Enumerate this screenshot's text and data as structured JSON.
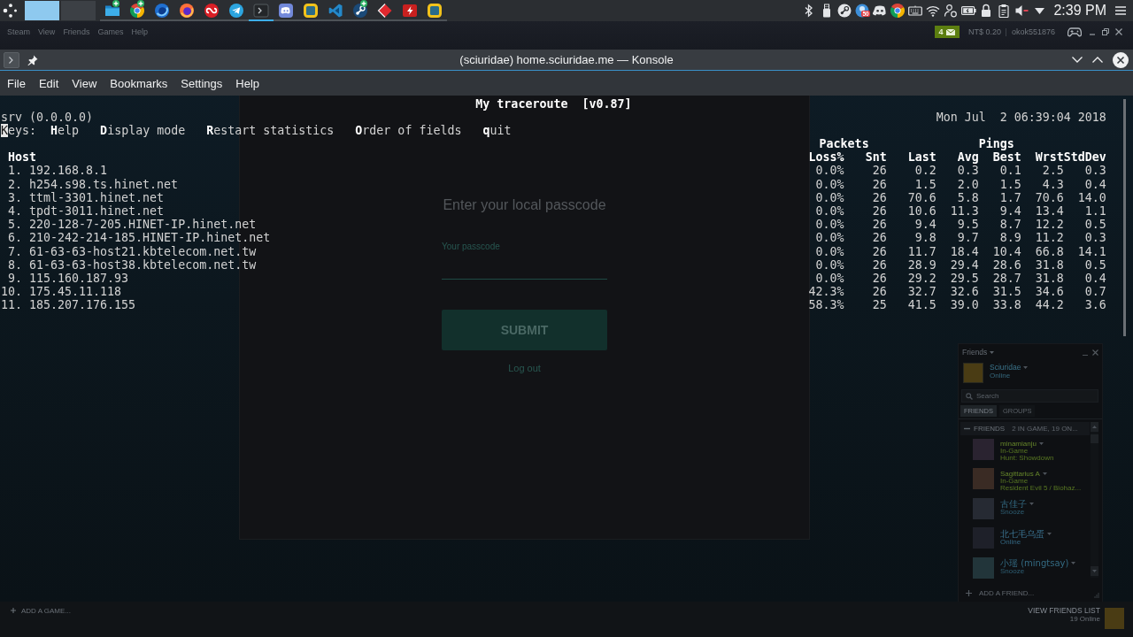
{
  "taskbar": {
    "desktops": [
      {
        "selected": true
      },
      {
        "selected": false
      }
    ],
    "apps": [
      {
        "kind": "folder",
        "badge": true,
        "running": true,
        "selected": false
      },
      {
        "kind": "chrome",
        "badge": true,
        "running": true,
        "selected": false
      },
      {
        "kind": "devfox",
        "badge": false,
        "running": true,
        "selected": false
      },
      {
        "kind": "firefox",
        "badge": false,
        "running": true,
        "selected": false
      },
      {
        "kind": "cloud",
        "badge": false,
        "running": true,
        "selected": false
      },
      {
        "kind": "telegram",
        "badge": false,
        "running": true,
        "selected": false
      },
      {
        "kind": "terminal",
        "badge": false,
        "running": true,
        "selected": true
      },
      {
        "kind": "discord",
        "badge": false,
        "running": true,
        "selected": false
      },
      {
        "kind": "frame",
        "badge": false,
        "running": true,
        "selected": false
      },
      {
        "kind": "code",
        "badge": false,
        "running": true,
        "selected": false
      },
      {
        "kind": "steam",
        "badge": true,
        "running": true,
        "selected": false
      },
      {
        "kind": "diamond",
        "badge": false,
        "running": true,
        "selected": false
      },
      {
        "kind": "bolt",
        "badge": false,
        "running": true,
        "selected": false
      },
      {
        "kind": "frame",
        "badge": false,
        "running": true,
        "selected": false
      }
    ],
    "tray": [
      {
        "kind": "bluetooth"
      },
      {
        "kind": "usb"
      },
      {
        "kind": "steam"
      },
      {
        "kind": "badged",
        "badge": "50"
      },
      {
        "kind": "discord"
      },
      {
        "kind": "chrome"
      },
      {
        "kind": "keyboard"
      },
      {
        "kind": "wifi"
      },
      {
        "kind": "user"
      },
      {
        "kind": "battery"
      },
      {
        "kind": "lock"
      },
      {
        "kind": "clipboard"
      },
      {
        "kind": "muted"
      },
      {
        "kind": "expand"
      }
    ],
    "clock": "2:39 PM"
  },
  "steam": {
    "menu": [
      "Steam",
      "View",
      "Friends",
      "Games",
      "Help"
    ],
    "notifications": "4",
    "wallet": "NT$ 0.20",
    "account": "okok551876",
    "passcode_dialog": {
      "heading": "Enter your local passcode",
      "field_label": "Your passcode",
      "submit": "SUBMIT",
      "logout": "Log out"
    },
    "friends_panel": {
      "title": "Friends",
      "user": {
        "name": "Sciuridae",
        "status": "Online"
      },
      "search": {
        "placeholder": "Search"
      },
      "tabs": [
        {
          "label": "FRIENDS",
          "selected": true
        },
        {
          "label": "GROUPS",
          "selected": false
        }
      ],
      "group": {
        "label": "FRIENDS",
        "summary": "2 IN GAME, 19 ON...",
        "expanded": true
      },
      "friends": [
        {
          "name": "minamianju",
          "status": "In-Game",
          "game": "Hunt: Showdown",
          "kind": "ingame"
        },
        {
          "name": "Sagittarius A",
          "status": "In-Game",
          "game": "Resident Evil 5 / Biohaz...",
          "kind": "ingame"
        },
        {
          "name": "古佳子",
          "status": "Snooze",
          "kind": "snooze"
        },
        {
          "name": "北七毛乌蛋",
          "status": "Online",
          "kind": "online"
        },
        {
          "name": "小瑶 (mingtsay)",
          "status": "Snooze",
          "kind": "snooze"
        }
      ],
      "add_friend": "ADD A FRIEND..."
    },
    "add_game": "ADD A GAME...",
    "view_friends": "VIEW FRIENDS LIST",
    "online_count": "19 Online"
  },
  "konsole": {
    "title": "(sciuridae) home.sciuridae.me — Konsole",
    "menu": [
      "File",
      "Edit",
      "View",
      "Bookmarks",
      "Settings",
      "Help"
    ],
    "terminal": {
      "title": "My traceroute  [v0.87]",
      "host": "srv (0.0.0.0)",
      "date": "Mon Jul  2 06:39:04 2018",
      "keys_label": {
        "text": "Keys:",
        "cursor": true
      },
      "keys": [
        "**H**elp",
        "**D**isplay mode",
        "**R**estart statistics",
        "**O**rder of fields",
        "**q**uit"
      ],
      "host_column": "Host",
      "column_groups": [
        {
          "label": "Packets",
          "columns": [
            "Loss%",
            "Snt"
          ]
        },
        {
          "label": "Pings",
          "columns": [
            "Last",
            "Avg",
            "Best",
            "Wrst",
            "StdDev"
          ]
        }
      ],
      "rows": [
        {
          "hop": "1.",
          "host": "192.168.8.1",
          "values": [
            "0.0%",
            "26",
            "0.2",
            "0.3",
            "0.1",
            "2.5",
            "0.3"
          ]
        },
        {
          "hop": "2.",
          "host": "h254.s98.ts.hinet.net",
          "values": [
            "0.0%",
            "26",
            "1.5",
            "2.0",
            "1.5",
            "4.3",
            "0.4"
          ]
        },
        {
          "hop": "3.",
          "host": "ttml-3301.hinet.net",
          "values": [
            "0.0%",
            "26",
            "70.6",
            "5.8",
            "1.7",
            "70.6",
            "14.0"
          ]
        },
        {
          "hop": "4.",
          "host": "tpdt-3011.hinet.net",
          "values": [
            "0.0%",
            "26",
            "10.6",
            "11.3",
            "9.4",
            "13.4",
            "1.1"
          ]
        },
        {
          "hop": "5.",
          "host": "220-128-7-205.HINET-IP.hinet.net",
          "values": [
            "0.0%",
            "26",
            "9.4",
            "9.5",
            "8.7",
            "12.2",
            "0.5"
          ]
        },
        {
          "hop": "6.",
          "host": "210-242-214-185.HINET-IP.hinet.net",
          "values": [
            "0.0%",
            "26",
            "9.8",
            "9.7",
            "8.9",
            "11.2",
            "0.3"
          ]
        },
        {
          "hop": "7.",
          "host": "61-63-63-host21.kbtelecom.net.tw",
          "values": [
            "0.0%",
            "26",
            "11.7",
            "18.4",
            "10.4",
            "66.8",
            "14.1"
          ]
        },
        {
          "hop": "8.",
          "host": "61-63-63-host38.kbtelecom.net.tw",
          "values": [
            "0.0%",
            "26",
            "28.9",
            "29.4",
            "28.6",
            "31.8",
            "0.5"
          ]
        },
        {
          "hop": "9.",
          "host": "115.160.187.93",
          "values": [
            "0.0%",
            "26",
            "29.2",
            "29.5",
            "28.7",
            "31.8",
            "0.4"
          ]
        },
        {
          "hop": "10.",
          "host": "175.45.11.118",
          "values": [
            "42.3%",
            "26",
            "32.7",
            "32.6",
            "31.5",
            "34.6",
            "0.7"
          ]
        },
        {
          "hop": "11.",
          "host": "185.207.176.155",
          "values": [
            "58.3%",
            "25",
            "41.5",
            "39.0",
            "33.8",
            "44.2",
            "3.6"
          ]
        }
      ]
    }
  }
}
